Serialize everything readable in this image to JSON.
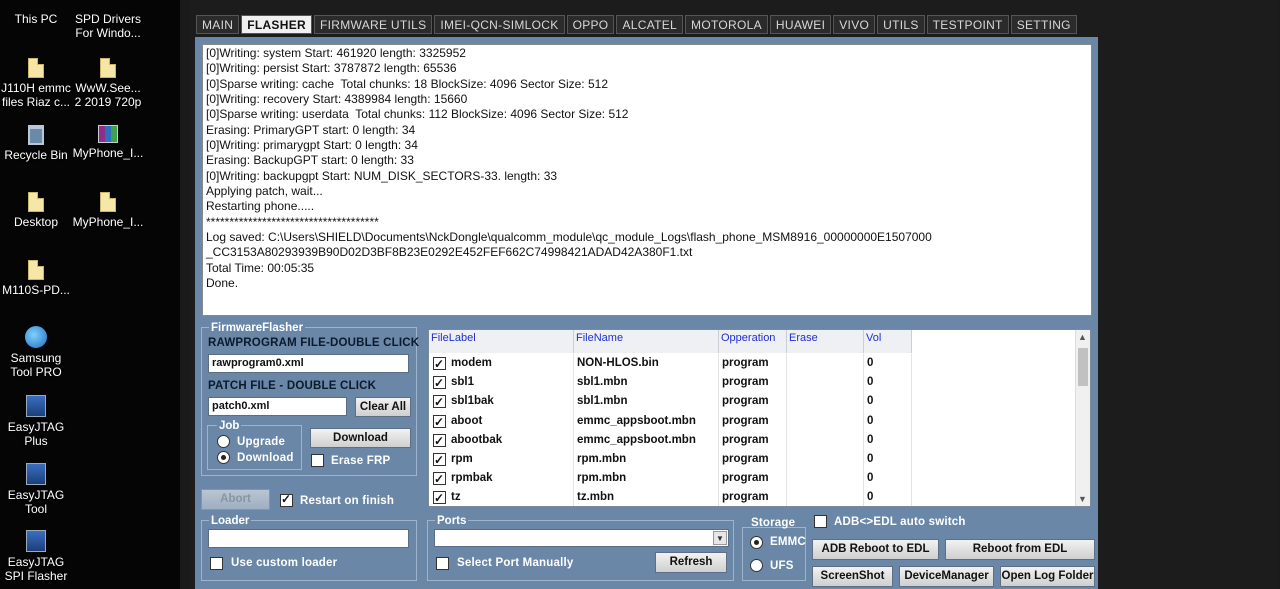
{
  "desktop": {
    "icons": [
      {
        "label": "This PC",
        "icon": "computer-icon"
      },
      {
        "label": "SPD Drivers For Windo...",
        "icon": "file-icon"
      },
      {
        "label": "J110H emmc files Riaz c...",
        "icon": "file-icon"
      },
      {
        "label": "WwW.See... 2 2019 720p",
        "icon": "file-icon"
      },
      {
        "label": "Recycle Bin",
        "icon": "recycle-bin-icon"
      },
      {
        "label": "MyPhone_I...",
        "icon": "winrar-icon"
      },
      {
        "label": "Desktop",
        "icon": "file-icon"
      },
      {
        "label": "MyPhone_I...",
        "icon": "file-icon"
      },
      {
        "label": "M110S-PD...",
        "icon": "file-icon"
      },
      {
        "label": "Samsung Tool PRO",
        "icon": "samsung-tool-icon"
      },
      {
        "label": "EasyJTAG Plus",
        "icon": "easyjtag-icon"
      },
      {
        "label": "EasyJTAG Tool",
        "icon": "easyjtag-icon"
      },
      {
        "label": "EasyJTAG SPI Flasher",
        "icon": "easyjtag-icon"
      }
    ]
  },
  "tabs": [
    "MAIN",
    "FLASHER",
    "FIRMWARE UTILS",
    "IMEI-QCN-SIMLOCK",
    "OPPO",
    "ALCATEL",
    "MOTOROLA",
    "HUAWEI",
    "VIVO",
    "UTILS",
    "TESTPOINT",
    "SETTING"
  ],
  "active_tab": "FLASHER",
  "log": "[0]Writing: system Start: 461920 length: 3325952\n[0]Writing: persist Start: 3787872 length: 65536\n[0]Sparse writing: cache  Total chunks: 18 BlockSize: 4096 Sector Size: 512\n[0]Writing: recovery Start: 4389984 length: 15660\n[0]Sparse writing: userdata  Total chunks: 112 BlockSize: 4096 Sector Size: 512\nErasing: PrimaryGPT start: 0 length: 34\n[0]Writing: primarygpt Start: 0 length: 34\nErasing: BackupGPT start: 0 length: 33\n[0]Writing: backupgpt Start: NUM_DISK_SECTORS-33. length: 33\nApplying patch, wait...\nRestarting phone.....\n*************************************\nLog saved: C:\\Users\\SHIELD\\Documents\\NckDongle\\qualcomm_module\\qc_module_Logs\\flash_phone_MSM8916_00000000E1507000\n_CC3153A80293939B90D02D3BF8B23E0292E452FEF662C74998421ADAD42A380F1.txt\nTotal Time: 00:05:35\nDone.",
  "firmware_flasher": {
    "title": "FirmwareFlasher",
    "rawprogram_label": "RAWPROGRAM FILE-DOUBLE CLICK",
    "rawprogram_value": "rawprogram0.xml",
    "patch_label": "PATCH FILE - DOUBLE CLICK",
    "patch_value": "patch0.xml",
    "clear_all": "Clear All",
    "job_label": "Job",
    "upgrade": "Upgrade",
    "download_radio": "Download",
    "download_button": "Download",
    "erase_frp": "Erase FRP"
  },
  "table": {
    "headers": [
      "FileLabel",
      "FileName",
      "Opperation",
      "Erase",
      "Vol"
    ],
    "rows": [
      {
        "label": "modem",
        "file": "NON-HLOS.bin",
        "op": "program",
        "vol": "0"
      },
      {
        "label": "sbl1",
        "file": "sbl1.mbn",
        "op": "program",
        "vol": "0"
      },
      {
        "label": "sbl1bak",
        "file": "sbl1.mbn",
        "op": "program",
        "vol": "0"
      },
      {
        "label": "aboot",
        "file": "emmc_appsboot.mbn",
        "op": "program",
        "vol": "0"
      },
      {
        "label": "abootbak",
        "file": "emmc_appsboot.mbn",
        "op": "program",
        "vol": "0"
      },
      {
        "label": "rpm",
        "file": "rpm.mbn",
        "op": "program",
        "vol": "0"
      },
      {
        "label": "rpmbak",
        "file": "rpm.mbn",
        "op": "program",
        "vol": "0"
      },
      {
        "label": "tz",
        "file": "tz.mbn",
        "op": "program",
        "vol": "0"
      }
    ]
  },
  "abort": "Abort",
  "restart_on_finish": "Restart on finish",
  "loader": {
    "title": "Loader",
    "value": "",
    "use_custom": "Use custom loader"
  },
  "ports": {
    "title": "Ports",
    "value": "",
    "select_manually": "Select Port Manually",
    "refresh": "Refresh"
  },
  "storage": {
    "title": "Storage",
    "emmc": "EMMC",
    "ufs": "UFS"
  },
  "actions": {
    "adb_edl_switch": "ADB<>EDL auto switch",
    "adb_reboot_edl": "ADB Reboot to EDL",
    "reboot_from_edl": "Reboot from EDL",
    "screenshot": "ScreenShot",
    "device_manager": "DeviceManager",
    "open_log_folder": "Open Log Folder"
  }
}
